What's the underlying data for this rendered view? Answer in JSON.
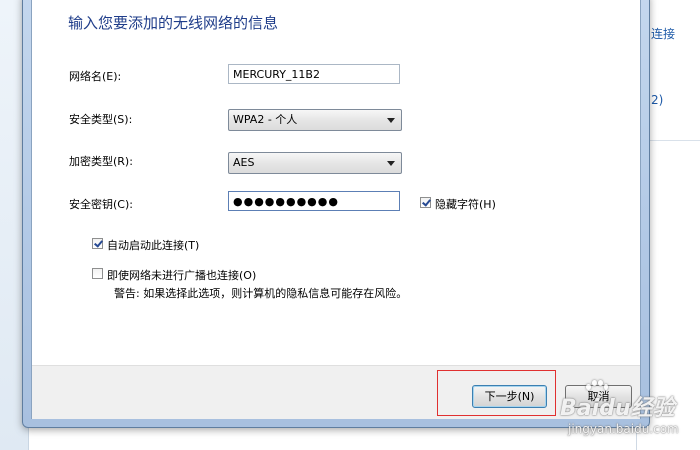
{
  "background": {
    "right_window": {
      "link1": "连接",
      "text2": "2)"
    }
  },
  "dialog": {
    "heading": "输入您要添加的无线网络的信息",
    "network_name": {
      "label": "网络名(E):",
      "value": "MERCURY_11B2"
    },
    "security_type": {
      "label": "安全类型(S):",
      "selected": "WPA2 - 个人"
    },
    "encryption_type": {
      "label": "加密类型(R):",
      "selected": "AES"
    },
    "security_key": {
      "label": "安全密钥(C):",
      "masked_value": "●●●●●●●●●●"
    },
    "hide_chars": {
      "label": "隐藏字符(H)",
      "checked": true
    },
    "auto_start": {
      "label": "自动启动此连接(T)",
      "checked": true
    },
    "connect_hidden": {
      "label": "即使网络未进行广播也连接(O)",
      "checked": false
    },
    "warning": "警告: 如果选择此选项，则计算机的隐私信息可能存在风险。",
    "buttons": {
      "next": "下一步(N)",
      "cancel": "取消"
    }
  },
  "watermark": {
    "logo": "Baidu经验",
    "sub": "jingyan.baidu.com"
  },
  "colors": {
    "heading": "#1f3d8a",
    "highlight": "#e03030",
    "link": "#1e5aa8"
  }
}
